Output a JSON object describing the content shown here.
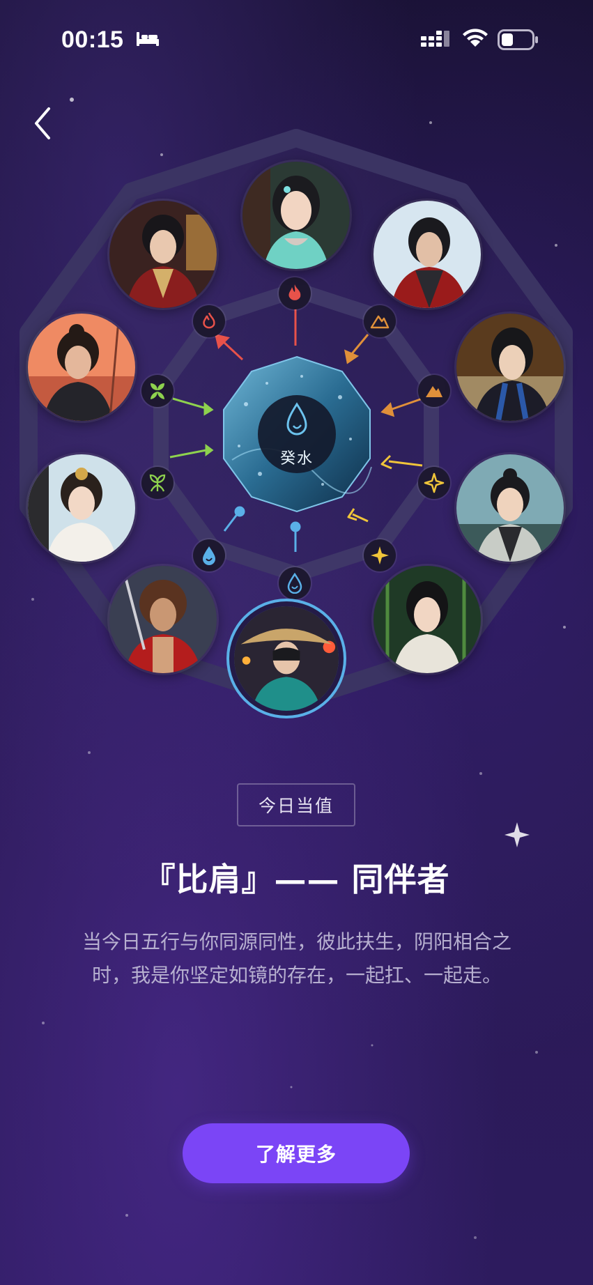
{
  "status_bar": {
    "time": "00:15",
    "sleep_icon": "bed-icon",
    "signal_icon": "cellular-signal-icon",
    "wifi_icon": "wifi-icon",
    "battery_icon": "battery-icon"
  },
  "navigation": {
    "back_icon": "chevron-left-icon"
  },
  "wheel": {
    "center_label": "癸水",
    "center_icon": "water-drop-icon",
    "elements": [
      {
        "id": "fire",
        "icon": "fire-icon",
        "color": "#e8524a"
      },
      {
        "id": "earth",
        "icon": "mountain-icon",
        "color": "#e0903a"
      },
      {
        "id": "metal",
        "icon": "diamond-icon",
        "color": "#f0c53a"
      },
      {
        "id": "water",
        "icon": "water-drop-icon",
        "color": "#5ab0e8"
      },
      {
        "id": "wood",
        "icon": "leaf-icon",
        "color": "#8ed24e"
      }
    ],
    "characters": [
      "character-jade-maiden",
      "character-red-coat-swordsman",
      "character-dark-haired-warrior",
      "character-blue-sash-scholar",
      "character-topknot-youth",
      "character-bamboo-maiden",
      "character-straw-hat-traveler",
      "character-red-vest-fighter",
      "character-white-robed-lady",
      "character-sunset-swordsman",
      "character-crimson-noble"
    ]
  },
  "today_tag": "今日当值",
  "headline": "『比肩』—— 同伴者",
  "description": "当今日五行与你同源同性，彼此扶生，阴阳相合之时，我是你坚定如镜的存在，一起扛、一起走。",
  "cta_button": "了解更多",
  "colors": {
    "accent": "#7b45f6",
    "background": "#24174b",
    "frame": "#3a3260"
  }
}
